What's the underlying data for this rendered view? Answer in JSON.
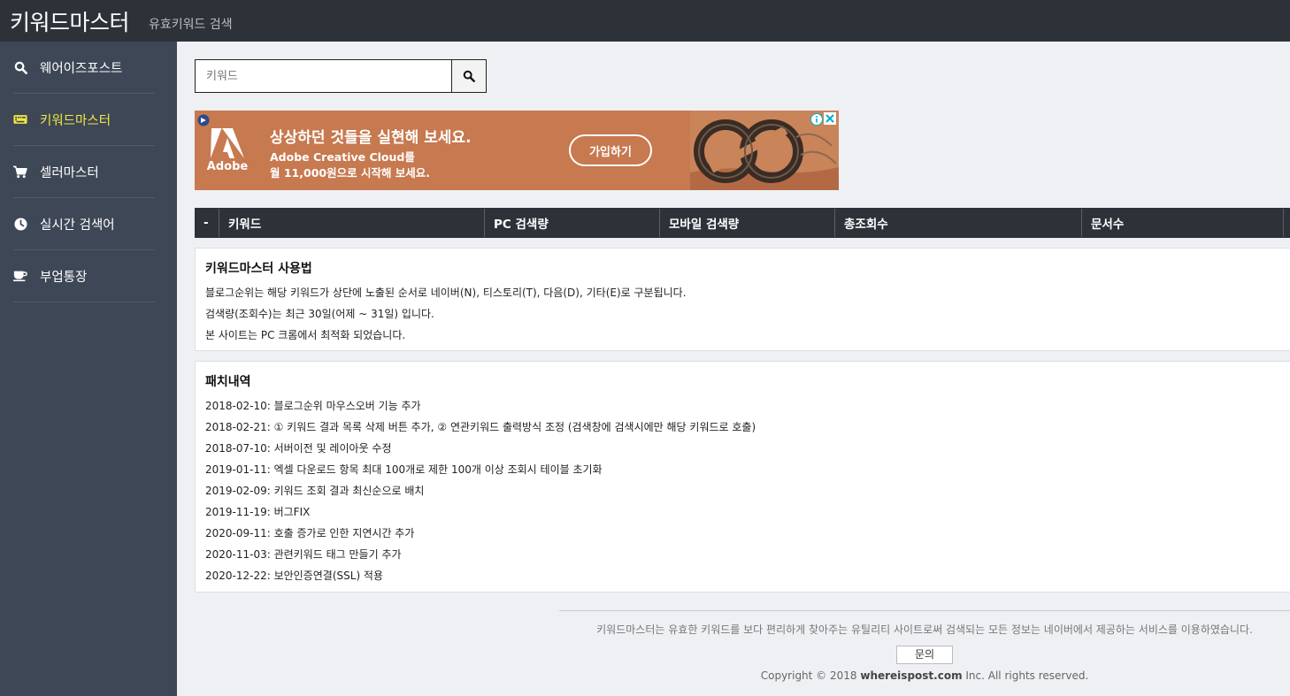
{
  "header": {
    "brand": "키워드마스터",
    "tagline": "유효키워드 검색"
  },
  "sidebar": {
    "items": [
      {
        "label": "웨어이즈포스트",
        "icon": "search-icon",
        "active": false
      },
      {
        "label": "키워드마스터",
        "icon": "keyboard-icon",
        "active": true
      },
      {
        "label": "셀러마스터",
        "icon": "cart-icon",
        "active": false
      },
      {
        "label": "실시간 검색어",
        "icon": "clock-icon",
        "active": false
      },
      {
        "label": "부업통장",
        "icon": "coffee-icon",
        "active": false
      }
    ]
  },
  "search": {
    "placeholder": "키워드",
    "value": ""
  },
  "ad": {
    "brand": "Adobe",
    "headline": "상상하던 것들을 실현해 보세요.",
    "line1": "Adobe Creative Cloud를",
    "line2": "월 11,000원으로 시작해 보세요.",
    "cta": "가입하기"
  },
  "table": {
    "headers": [
      "-",
      "키워드",
      "PC 검색량",
      "모바일 검색량",
      "총조회수",
      "문서수"
    ]
  },
  "usage": {
    "title": "키워드마스터 사용법",
    "lines": [
      "블로그순위는 해당 키워드가 상단에 노출된 순서로 네이버(N), 티스토리(T), 다음(D), 기타(E)로 구분됩니다.",
      "검색량(조회수)는 최근 30일(어제 ~ 31일) 입니다.",
      "본 사이트는 PC 크롬에서 최적화 되었습니다."
    ]
  },
  "patch": {
    "title": "패치내역",
    "lines": [
      "2018-02-10: 블로그순위 마우스오버 기능 추가",
      "2018-02-21: ① 키워드 결과 목록 삭제 버튼 추가, ② 연관키워드 출력방식 조정 (검색창에 검색시에만 해당 키워드로 호출)",
      "2018-07-10: 서버이전 및 레이아웃 수정",
      "2019-01-11: 엑셀 다운로드 항목 최대 100개로 제한 100개 이상 조회시 테이블 초기화",
      "2019-02-09: 키워드 조회 결과 최신순으로 배치",
      "2019-11-19: 버그FIX",
      "2020-09-11: 호출 증가로 인한 지연시간 추가",
      "2020-11-03: 관련키워드 태그 만들기 추가",
      "2020-12-22: 보안인증연결(SSL) 적용"
    ]
  },
  "footer": {
    "text": "키워드마스터는 유효한 키워드를 보다 편리하게 찾아주는 유틸리티 사이트로써 검색되는 모든 정보는 네이버에서 제공하는 서비스를 이용하였습니다.",
    "contact": "문의",
    "copy_prefix": "Copyright © 2018 ",
    "copy_domain": "whereispost.com",
    "copy_suffix": " Inc. All rights reserved."
  }
}
